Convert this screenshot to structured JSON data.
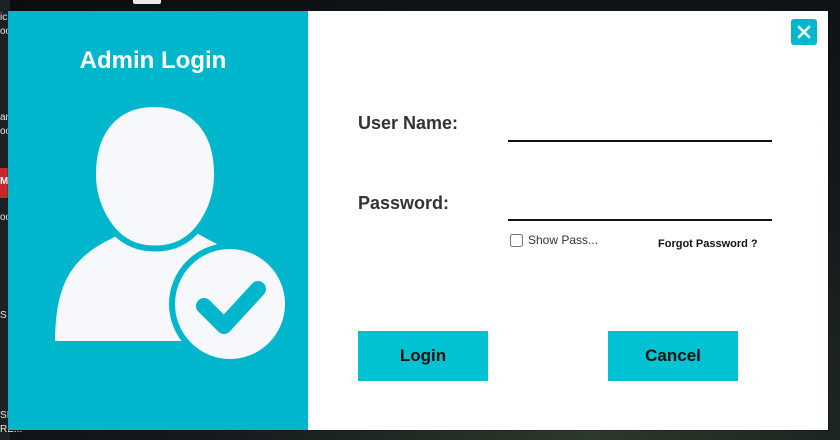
{
  "desktop": {
    "snippets": [
      "ic",
      "oo",
      "ar",
      "oo",
      "M",
      "oo",
      "S",
      "SE",
      "RE..."
    ]
  },
  "dialog": {
    "title": "Admin Login",
    "close_icon": "close-icon",
    "avatar_icon": "user-check-icon",
    "accent_color": "#00b6cd",
    "username": {
      "label": "User Name:",
      "value": ""
    },
    "password": {
      "label": "Password:",
      "value": ""
    },
    "show_password": {
      "label": "Show Pass...",
      "checked": false
    },
    "forgot_password": "Forgot Password ?",
    "login_button": "Login",
    "cancel_button": "Cancel"
  }
}
